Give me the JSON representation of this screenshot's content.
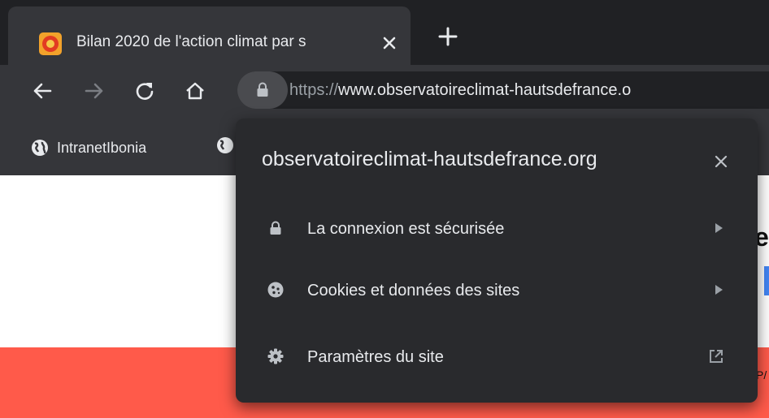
{
  "tab": {
    "title": "Bilan 2020 de l'action climat par s",
    "favicon": "site-favicon",
    "close_icon": "close-icon"
  },
  "toolbar": {
    "back_icon": "back-arrow-icon",
    "forward_icon": "forward-arrow-icon",
    "reload_icon": "reload-icon",
    "home_icon": "home-icon",
    "url_scheme": "https://",
    "url_host": "www.observatoireclimat-hautsdefrance.o"
  },
  "bookmarks": [
    {
      "label": "IntranetIbonia",
      "icon": "globe-icon"
    }
  ],
  "popup": {
    "title": "observatoireclimat-hautsdefrance.org",
    "rows": [
      {
        "label": "La connexion est sécurisée",
        "icon": "lock-icon",
        "trailing": "arrow-right-icon"
      },
      {
        "label": "Cookies et données des sites",
        "icon": "cookie-icon",
        "trailing": "arrow-right-icon"
      },
      {
        "label": "Paramètres du site",
        "icon": "gear-icon",
        "trailing": "external-link-icon"
      }
    ]
  },
  "page": {
    "partial_heading": "e",
    "partial_text": "P/",
    "strip_color": "#ff5a4a"
  },
  "colors": {
    "tab_strip": "#202124",
    "toolbar": "#35363a",
    "popup": "#292a2d",
    "text": "#e8eaed"
  }
}
